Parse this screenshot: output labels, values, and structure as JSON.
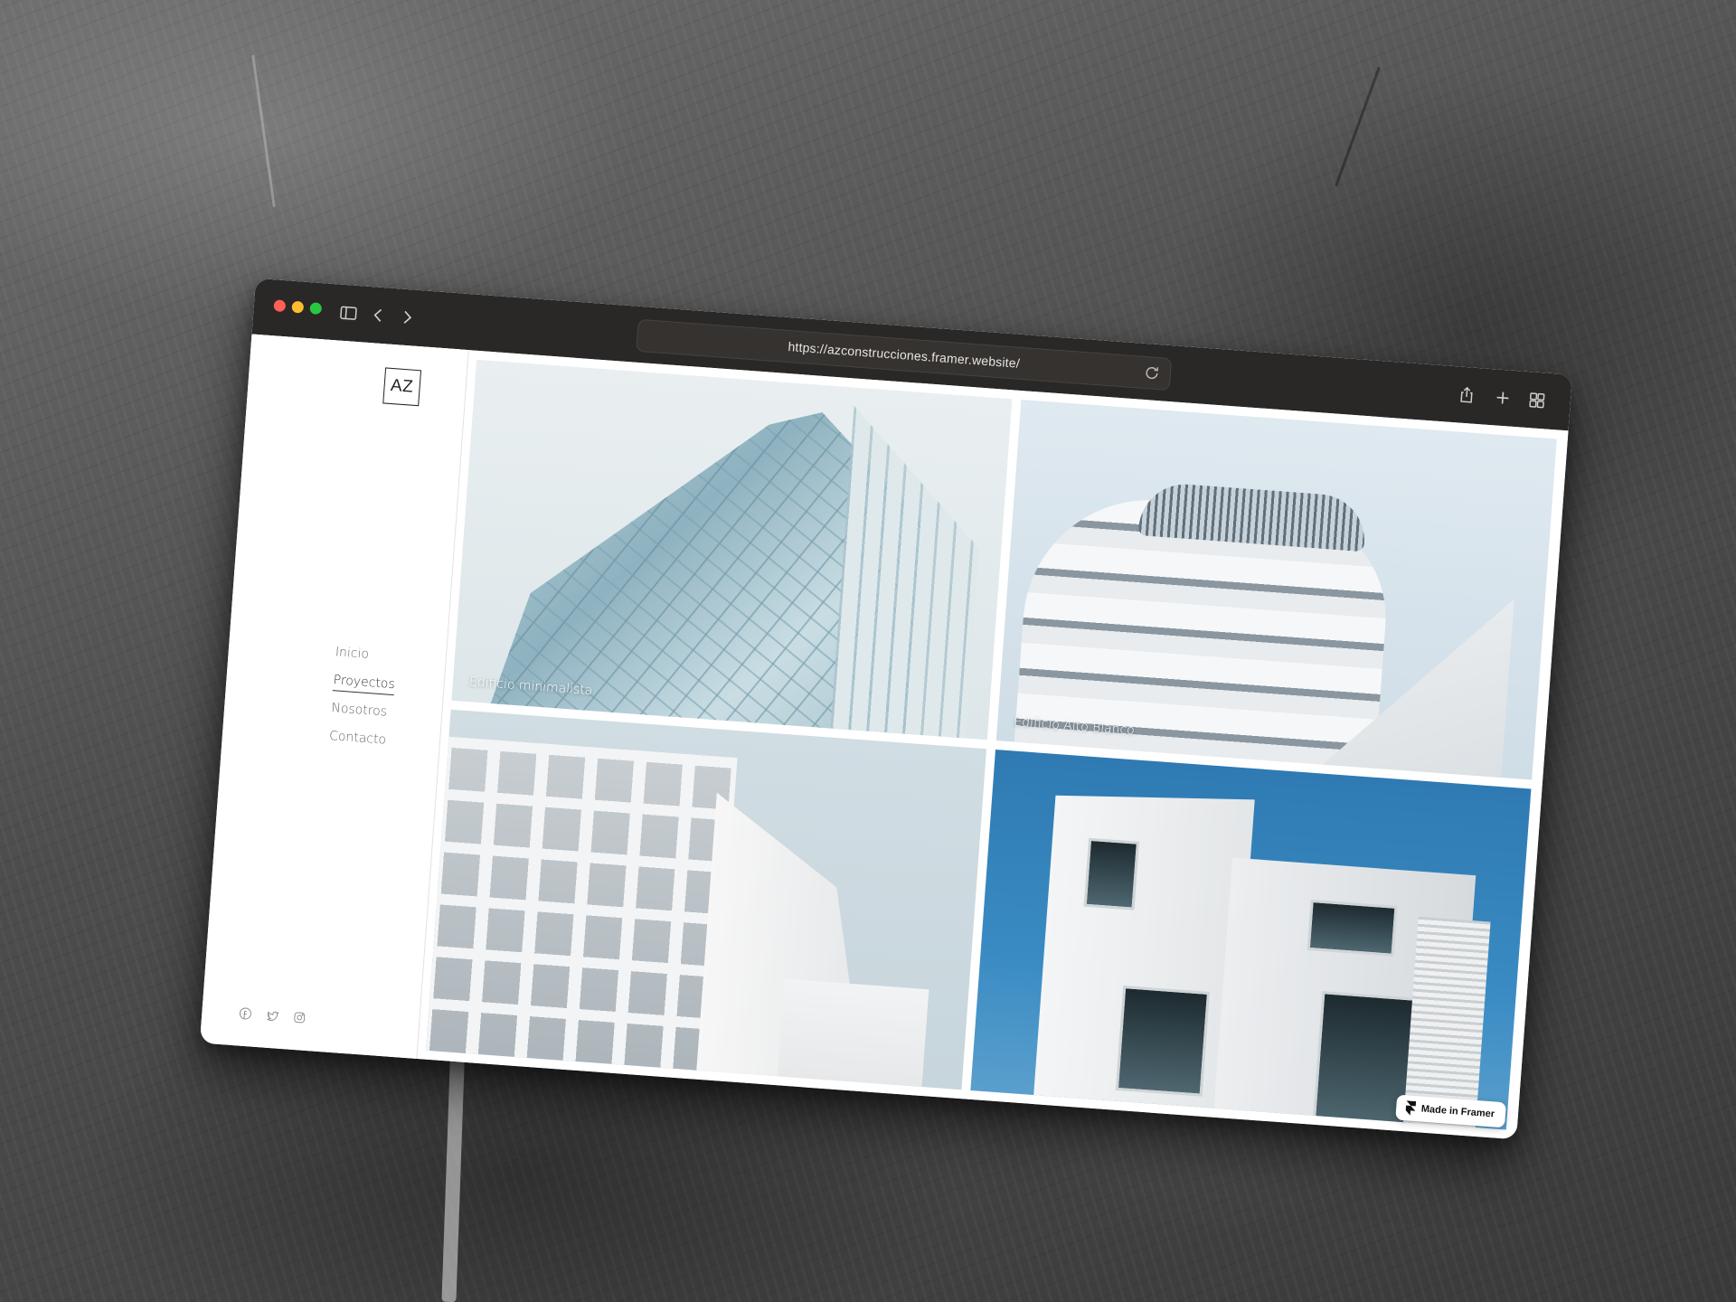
{
  "browser": {
    "url": "https://azconstrucciones.framer.website/",
    "window_controls": [
      "close",
      "minimize",
      "zoom"
    ],
    "toolbar_icons": [
      "sidebar-icon",
      "back-icon",
      "forward-icon",
      "reload-icon",
      "share-icon",
      "new-tab-icon",
      "tab-overview-icon"
    ]
  },
  "site": {
    "logo": "AZ",
    "nav": [
      {
        "label": "Inicio",
        "active": false
      },
      {
        "label": "Proyectos",
        "active": true
      },
      {
        "label": "Nosotros",
        "active": false
      },
      {
        "label": "Contacto",
        "active": false
      }
    ],
    "social_icons": [
      "facebook-icon",
      "twitter-icon",
      "instagram-icon"
    ],
    "projects": [
      {
        "caption": "Edificio minimalista"
      },
      {
        "caption": "Edificio Alto Blanco"
      },
      {
        "caption": ""
      },
      {
        "caption": ""
      }
    ],
    "badge": "Made in Framer"
  },
  "colors": {
    "toolbar_bg": "#2a2826",
    "page_bg": "#ffffff",
    "text": "#333333",
    "close": "#ff5f57",
    "minimize": "#febc2e",
    "zoom": "#28c840"
  }
}
